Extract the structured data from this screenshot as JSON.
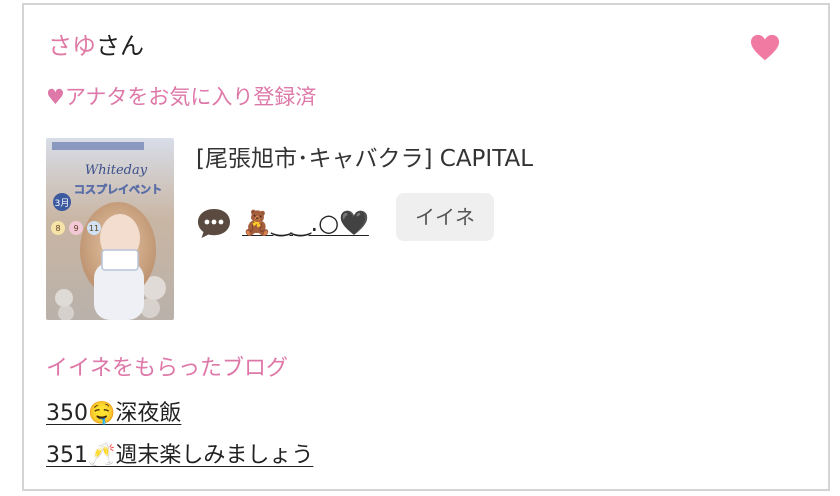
{
  "user": {
    "name": "さゆ",
    "suffix": "さん"
  },
  "favorite": {
    "status_text": "♥アナタをお気に入り登録済",
    "icon": "heart-icon",
    "color": "#f07aa2"
  },
  "thumbnail": {
    "headline": "Whiteday",
    "subhead": "コスプレイベント",
    "badge": "3月",
    "dates": [
      "8",
      "9",
      "11"
    ]
  },
  "shop": {
    "label": "[尾張旭市･キャバクラ]  CAPITAL"
  },
  "profile": {
    "message_icon": "speech-bubble-icon",
    "display_name": "🧸‿‿.○🖤"
  },
  "iine_button": {
    "label": "イイネ"
  },
  "blogs": {
    "title": "イイネをもらったブログ",
    "items": [
      {
        "label": "350🤤深夜飯"
      },
      {
        "label": "351🥂週末楽しみましょう"
      }
    ]
  },
  "colors": {
    "accent_pink": "#de78a8",
    "border": "#d4d4d4",
    "button_bg": "#efefef"
  }
}
